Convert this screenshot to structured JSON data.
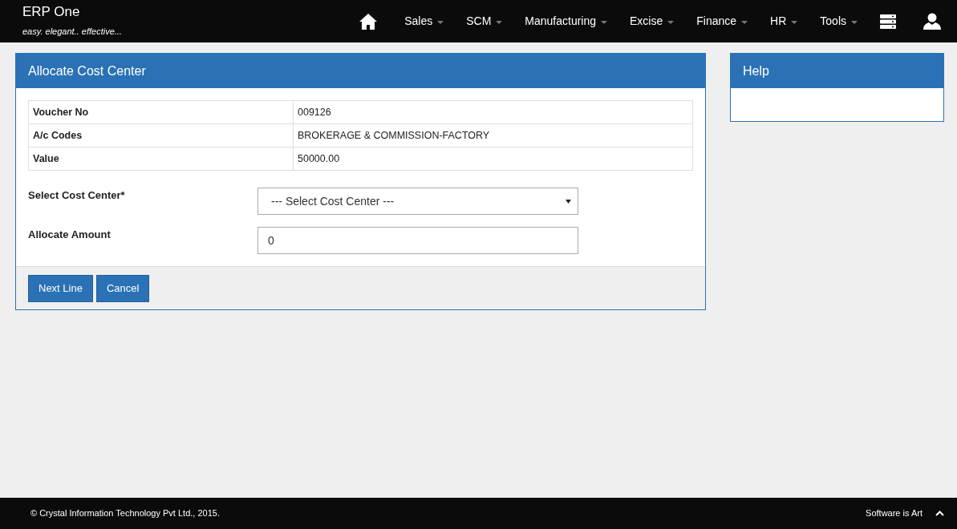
{
  "brand": {
    "title": "ERP One",
    "tagline": "easy. elegant.. effective..."
  },
  "nav": {
    "menus": [
      {
        "label": "Sales"
      },
      {
        "label": "SCM"
      },
      {
        "label": "Manufacturing"
      },
      {
        "label": "Excise"
      },
      {
        "label": "Finance"
      },
      {
        "label": "HR"
      },
      {
        "label": "Tools"
      }
    ]
  },
  "main_panel": {
    "title": "Allocate Cost Center",
    "details": [
      {
        "label": "Voucher No",
        "value": "009126"
      },
      {
        "label": "A/c Codes",
        "value": "BROKERAGE & COMMISSION-FACTORY"
      },
      {
        "label": "Value",
        "value": "50000.00"
      }
    ],
    "fields": [
      {
        "kind": "select",
        "label": "Select Cost Center*",
        "value": "--- Select Cost Center ---"
      },
      {
        "kind": "input",
        "label": "Allocate Amount",
        "value": "0"
      }
    ],
    "buttons": [
      "Next Line",
      "Cancel"
    ]
  },
  "help_panel": {
    "title": "Help"
  },
  "footer": {
    "copyright": "© Crystal Information Technology Pvt Ltd., 2015.",
    "motto": "Software is Art"
  }
}
